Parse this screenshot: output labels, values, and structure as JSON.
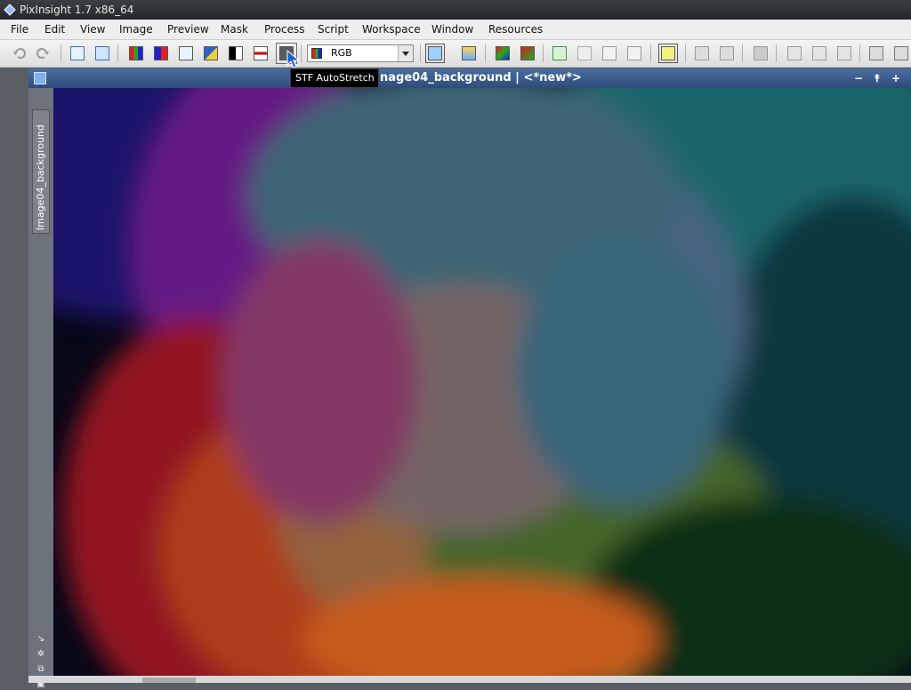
{
  "window": {
    "title": "PixInsight 1.7 x86_64"
  },
  "menu": [
    "File",
    "Edit",
    "View",
    "Image",
    "Preview",
    "Mask",
    "Process",
    "Script",
    "Workspace",
    "Window",
    "Resources"
  ],
  "toolbar": {
    "channel_select": "RGB",
    "tooltip": "STF AutoStretch",
    "highlight_color": "#ffeb00"
  },
  "image_window": {
    "title": "Image04_background | <*new*>",
    "title_visible": "nage04_background | <*new*>",
    "side_tab": "Image04_background",
    "title_bar_color": "#3d5f92"
  },
  "icons": {
    "undo": "undo-icon",
    "redo": "redo-icon",
    "window_min": "minimize-icon",
    "window_shade": "shade-icon",
    "window_max": "maximize-icon"
  }
}
